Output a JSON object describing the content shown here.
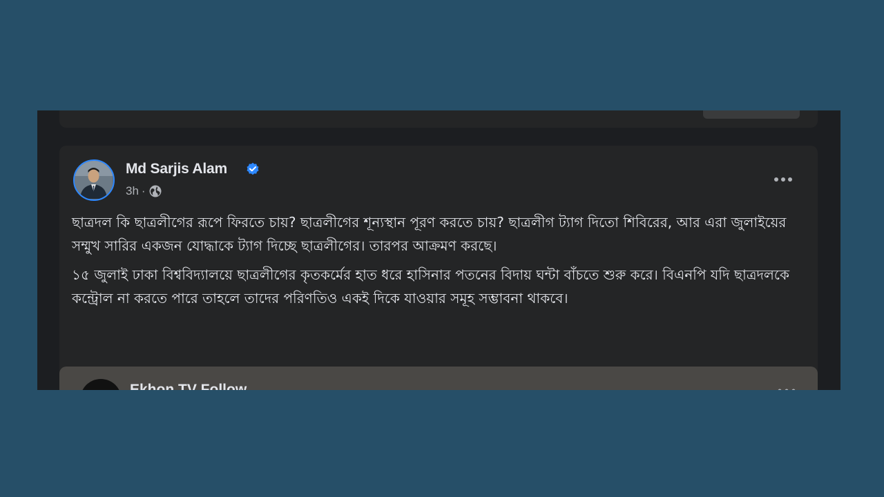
{
  "previous_post": {},
  "post": {
    "author": "Md Sarjis Alam",
    "time": "3h",
    "separator": "·",
    "paragraphs": [
      "ছাত্রদল কি ছাত্রলীগের রূপে ফিরতে চায়? ছাত্রলীগের শূন্যস্থান পূরণ করতে চায়? ছাত্রলীগ ট্যাগ দিতো শিবিরের, আর এরা জুলাইয়ের সম্মুখ সারির একজন যোদ্ধাকে ট্যাগ দিচ্ছে ছাত্রলীগের। তারপর আক্রমণ করছে।",
      "১৫ জুলাই ঢাকা বিশ্ববিদ্যালয়ে ছাত্রলীগের কৃতকর্মের হাত ধরে হাসিনার পতনের বিদায় ঘন্টা বাঁচতে শুরু করে। বিএনপি যদি ছাত্রদলকে কন্ট্রোল না করতে পারে তাহলে তাদের পরিণতিও একই দিকে যাওয়ার সমূহ সম্ভাবনা থাকবে।"
    ]
  },
  "shared_post": {
    "title": "Ekhon TV  Follow"
  },
  "icons": {
    "verified": "verified-badge-icon",
    "audience": "globe-icon",
    "more": "more-options-icon"
  },
  "colors": {
    "page_background": "#264f68",
    "feed_background": "#1c1e21",
    "card_background": "#242526",
    "text_primary": "#e4e6eb",
    "text_secondary": "#b0b3b8",
    "accent": "#2d88ff"
  }
}
